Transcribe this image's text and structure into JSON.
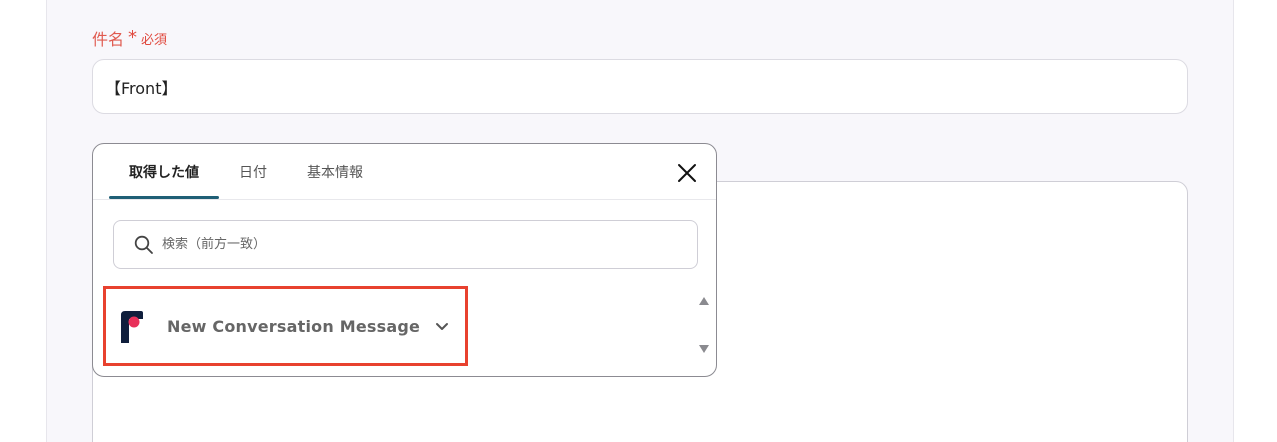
{
  "form": {
    "subject_label": "件名",
    "required_mark": "*",
    "required_text": "必須",
    "subject_value": "【Front】"
  },
  "popup": {
    "tabs": [
      {
        "label": "取得した値",
        "active": true
      },
      {
        "label": "日付",
        "active": false
      },
      {
        "label": "基本情報",
        "active": false
      }
    ],
    "search_placeholder": "検索（前方一致）",
    "items": [
      {
        "label": "New Conversation Message",
        "icon": "front-app-logo",
        "expanded": false
      }
    ]
  },
  "colors": {
    "accent": "#1f5f76",
    "required": "#e04a3f",
    "highlight": "#e8412f",
    "logo_dark": "#0f1e3c",
    "logo_pink": "#e8305a"
  }
}
